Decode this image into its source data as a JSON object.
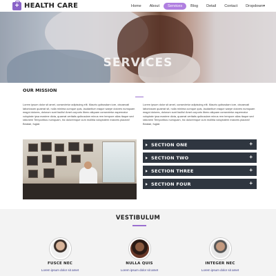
{
  "nav": {
    "logo_text": "HEALTH CARE",
    "logo_icon": "medical-bag-icon",
    "items": [
      {
        "label": "Home"
      },
      {
        "label": "About"
      },
      {
        "label": "Services",
        "active": true
      },
      {
        "label": "Blog"
      },
      {
        "label": "Detail"
      },
      {
        "label": "Contact"
      },
      {
        "label": "Dropdown▾"
      }
    ],
    "accent_color": "#b07fe0"
  },
  "hero": {
    "title": "SERVICES"
  },
  "mission": {
    "title": "OUR MISSION",
    "paragraph_left": "Lorem ipsum dolor sit amet, consectetur adipiscing elit. Mauris quibusdam iure, obcaecati laboriosam quaerat sit, nulla minima cumque quis, laudantium eaque saepe dolores numquam magni dolores, dolorum sunt facilis! Amet corporis libero aliquam consectetur aspernatur voluptate ipsa maxime dicta, quaerat veritatis quibusdam minus rem tempore alias itaque sed rationem Temporibus numquam, hic doloremque cum mollitia voluptatem maiores placeat! Beatae, fugiat.",
    "paragraph_right": "Lorem ipsum dolor sit amet, consectetur adipiscing elit. Mauris quibusdam iure, obcaecati laboriosam quaerat sit, nulla minima cumque quis, laudantium eaque saepe dolores numquam magni dolores, dolorum sunt facilis! Amet corporis libero aliquam consectetur aspernatur voluptate ipsa maxime dicta, quaerat veritatis quibusdam minus rem tempore alias itaque sed rationem Temporibus numquam, hic doloremque cum mollitia voluptatem maiores placeat! Beatae, fugiat."
  },
  "accordion": {
    "items": [
      {
        "label": "SECTION ONE"
      },
      {
        "label": "SECTION TWO"
      },
      {
        "label": "SECTION THREE"
      },
      {
        "label": "SECTION FOUR"
      }
    ],
    "background": "#2f3640"
  },
  "team": {
    "title": "VESTIBULUM",
    "members": [
      {
        "name": "FUSCE NEC",
        "text": "Lorem ipsum dolor sit amet"
      },
      {
        "name": "NULLA QUIS",
        "text": "Lorem ipsum dolor sit amet"
      },
      {
        "name": "INTEGER NEC",
        "text": "Lorem ipsum dolor sit amet"
      }
    ]
  }
}
